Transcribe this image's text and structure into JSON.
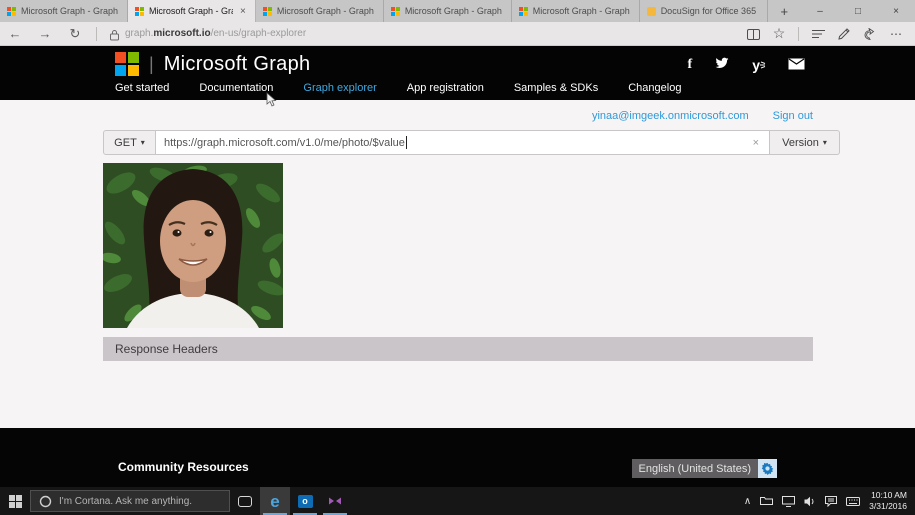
{
  "browser": {
    "tabs": [
      {
        "title": "Microsoft Graph - Graph |"
      },
      {
        "title": "Microsoft Graph - Gra",
        "close": "×"
      },
      {
        "title": "Microsoft Graph - Graph |"
      },
      {
        "title": "Microsoft Graph - Graph |"
      },
      {
        "title": "Microsoft Graph - Graph |"
      },
      {
        "title": "DocuSign for Office 365"
      }
    ],
    "url": {
      "prefix": "graph.",
      "domain": "microsoft.io",
      "path": "/en-us/graph-explorer"
    }
  },
  "icons": {
    "back": "←",
    "forward": "→",
    "refresh": "↻",
    "star": "☆",
    "hub": "≡",
    "more": "⋯",
    "new_tab": "+",
    "minimize": "–",
    "maximize": "□",
    "close": "×",
    "caret_down": "▾",
    "tray_chevron": "∧",
    "task_view": "▭"
  },
  "site": {
    "brand": "Microsoft Graph",
    "brand_separator": "|",
    "nav": [
      "Get started",
      "Documentation",
      "Graph explorer",
      "App registration",
      "Samples & SDKs",
      "Changelog"
    ],
    "account_email": "yinaa@imgeek.onmicrosoft.com",
    "sign_out_label": "Sign out",
    "request": {
      "method": "GET",
      "url_value": "https://graph.microsoft.com/v1.0/me/photo/$value",
      "clear_label": "×",
      "version_label": "Version"
    },
    "response_headers_label": "Response Headers",
    "footer": {
      "community_label": "Community Resources",
      "language_value": "English (United States)"
    }
  },
  "taskbar": {
    "cortana_placeholder": "I'm Cortana. Ask me anything.",
    "clock_time": "10:10 AM",
    "clock_date": "3/31/2016"
  },
  "colors": {
    "accent_blue": "#3fa9e0",
    "link_blue": "#2e9ad8",
    "ms_red": "#f25022",
    "ms_green": "#7fba00",
    "ms_blue": "#00a4ef",
    "ms_yellow": "#ffb900",
    "docusign_yellow": "#f5b73c",
    "edge_blue": "#4ba6e0",
    "outlook_blue": "#0e6cb5",
    "vs_purple": "#a258b5",
    "gear_blue": "#1b79c0"
  }
}
